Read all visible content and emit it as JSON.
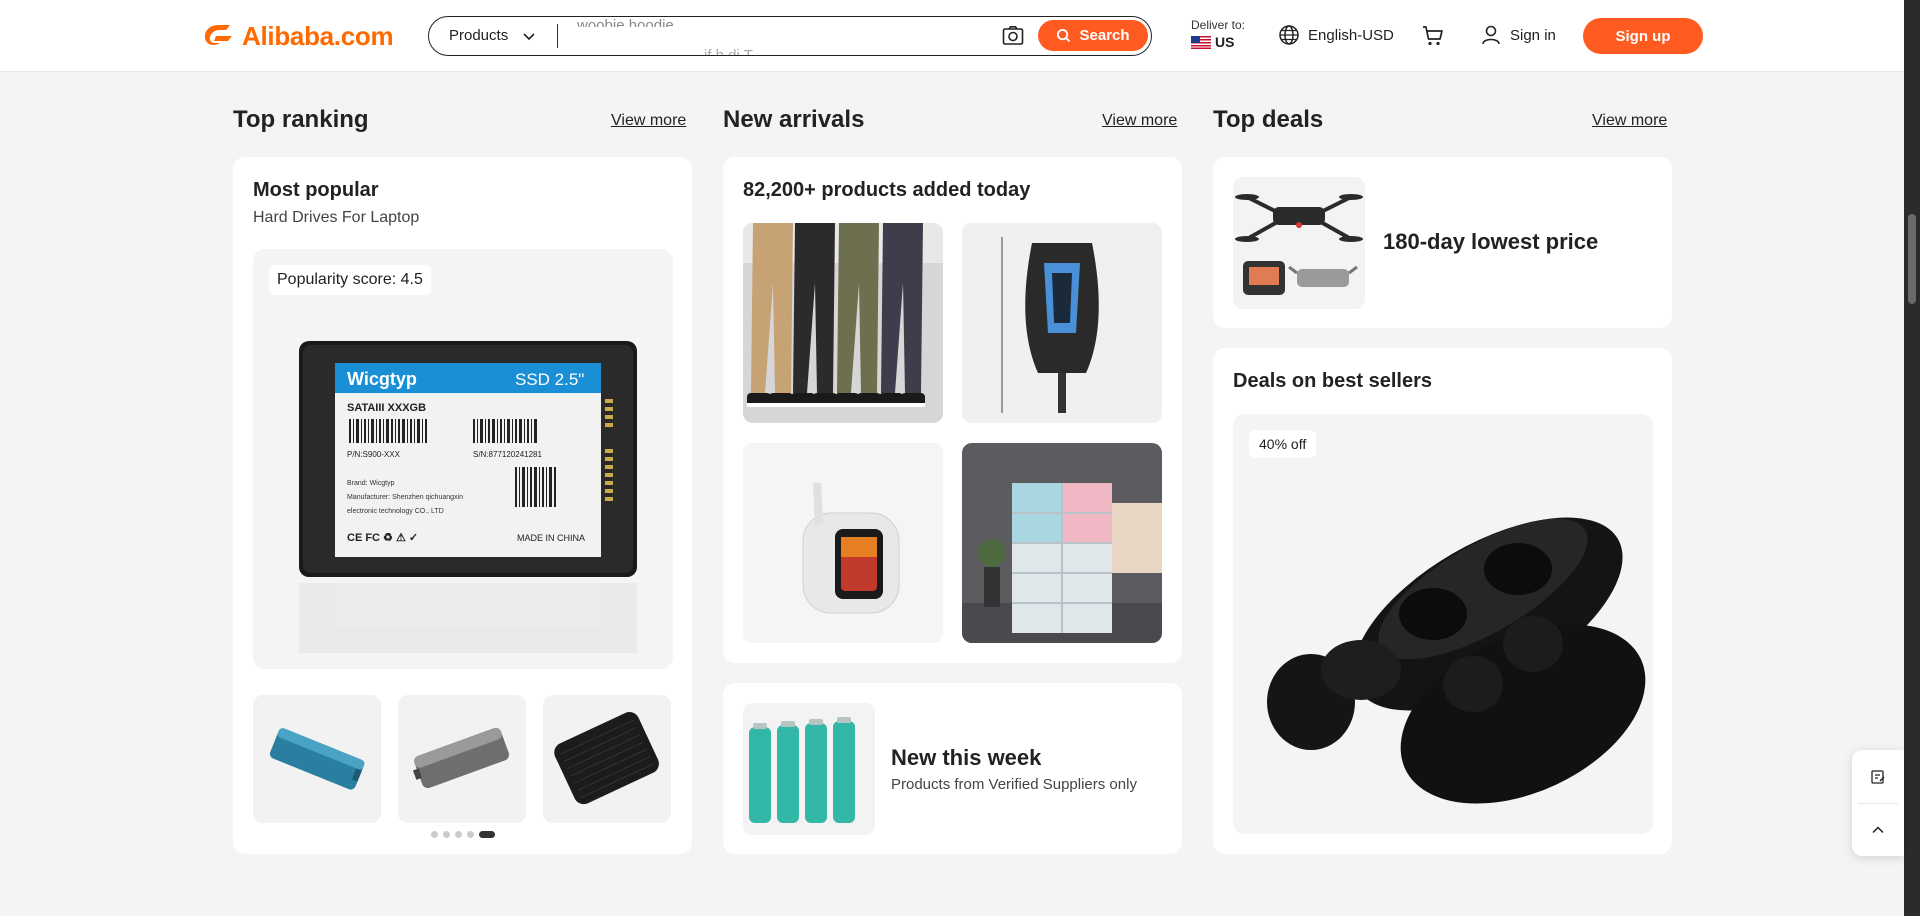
{
  "header": {
    "logo_text": "Alibaba.com",
    "search": {
      "category": "Products",
      "value": "woobie hoodie",
      "ghost_next": "if h di  T",
      "button_label": "Search"
    },
    "deliver": {
      "label": "Deliver to:",
      "country": "US"
    },
    "language": "English-USD",
    "sign_in": "Sign in",
    "sign_up": "Sign up"
  },
  "sections": {
    "top_ranking": {
      "title": "Top ranking",
      "view_more": "View more",
      "card_title": "Most popular",
      "card_subtitle": "Hard Drives For Laptop",
      "popularity_label": "Popularity score:",
      "popularity_value": "4.5",
      "product_image": "ssd-2.5-inch-wicgtyp",
      "thumbnails": [
        "blue-external-ssd",
        "gray-external-ssd",
        "black-external-hdd"
      ],
      "carousel_dots": 5,
      "carousel_active": 4
    },
    "new_arrivals": {
      "title": "New arrivals",
      "view_more": "View more",
      "headline": "82,200+ products added today",
      "images": [
        "cargo-pants",
        "phone-cooler",
        "smart-earbuds-case",
        "shoe-storage-boxes"
      ],
      "week_title": "New this week",
      "week_subtitle": "Products from Verified Suppliers only",
      "week_image": "18650-batteries"
    },
    "top_deals": {
      "title": "Top deals",
      "view_more": "View more",
      "lowest_price_text": "180-day lowest price",
      "lowest_price_image": "drone-set",
      "best_sellers_title": "Deals on best sellers",
      "discount_badge": "40% off",
      "best_sellers_image": "black-wireless-earbuds"
    }
  },
  "colors": {
    "brand": "#ff6a00",
    "accent": "#ff5a1f",
    "page_bg": "#f4f4f4"
  }
}
